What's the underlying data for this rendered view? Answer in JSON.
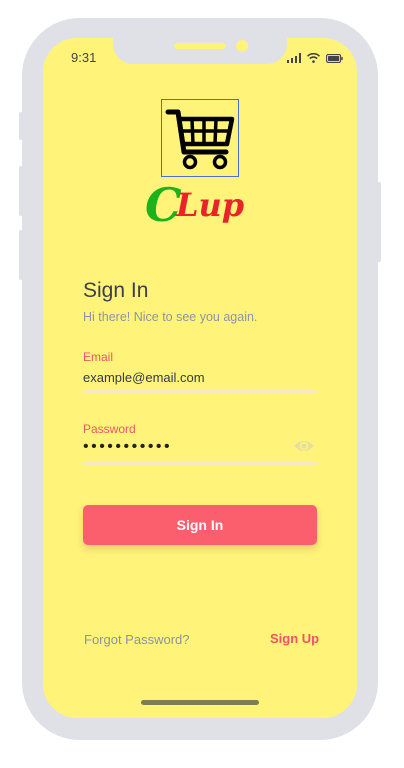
{
  "status_bar": {
    "time": "9:31"
  },
  "brand": {
    "name_part1": "C",
    "name_part2": "Lup"
  },
  "header": {
    "title": "Sign In",
    "subtitle": "Hi there! Nice to see you again."
  },
  "form": {
    "email_label": "Email",
    "email_value": "example@email.com",
    "password_label": "Password",
    "password_mask": "•••••••••••"
  },
  "actions": {
    "sign_in_label": "Sign In",
    "forgot_label": "Forgot Password?",
    "sign_up_label": "Sign Up"
  },
  "colors": {
    "screen_bg": "#fff479",
    "accent": "#fb5f6e",
    "label": "#f0556b",
    "brand_green": "#1bb31b",
    "brand_red": "#e8232a"
  },
  "icons": [
    "signal-icon",
    "wifi-icon",
    "battery-icon",
    "shopping-cart-icon",
    "eye-icon"
  ]
}
